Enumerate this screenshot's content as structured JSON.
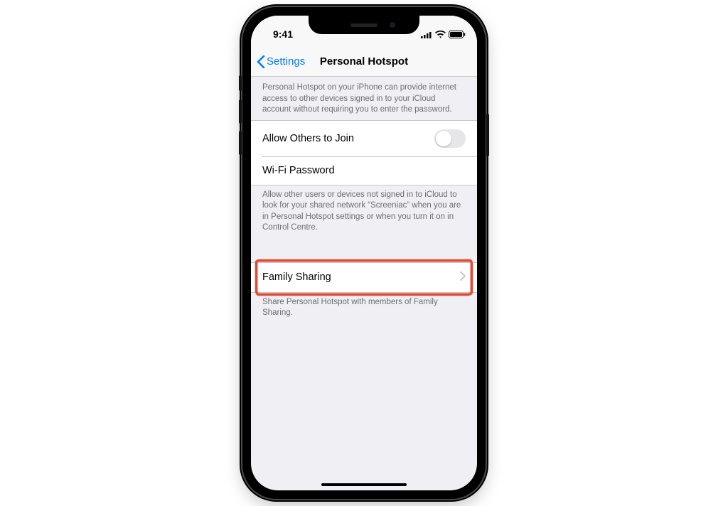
{
  "status": {
    "time": "9:41"
  },
  "nav": {
    "back_label": "Settings",
    "title": "Personal Hotspot"
  },
  "group1": {
    "header_note": "Personal Hotspot on your iPhone can provide internet access to other devices signed in to your iCloud account without requiring you to enter the password.",
    "allow_others_label": "Allow Others to Join",
    "wifi_password_label": "Wi-Fi Password",
    "footer_note": "Allow other users or devices not signed in to iCloud to look for your shared network “Screeniac” when you are in Personal Hotspot settings or when you turn it on in Control Centre."
  },
  "group2": {
    "family_sharing_label": "Family Sharing",
    "footer_note": "Share Personal Hotspot with members of Family Sharing."
  }
}
